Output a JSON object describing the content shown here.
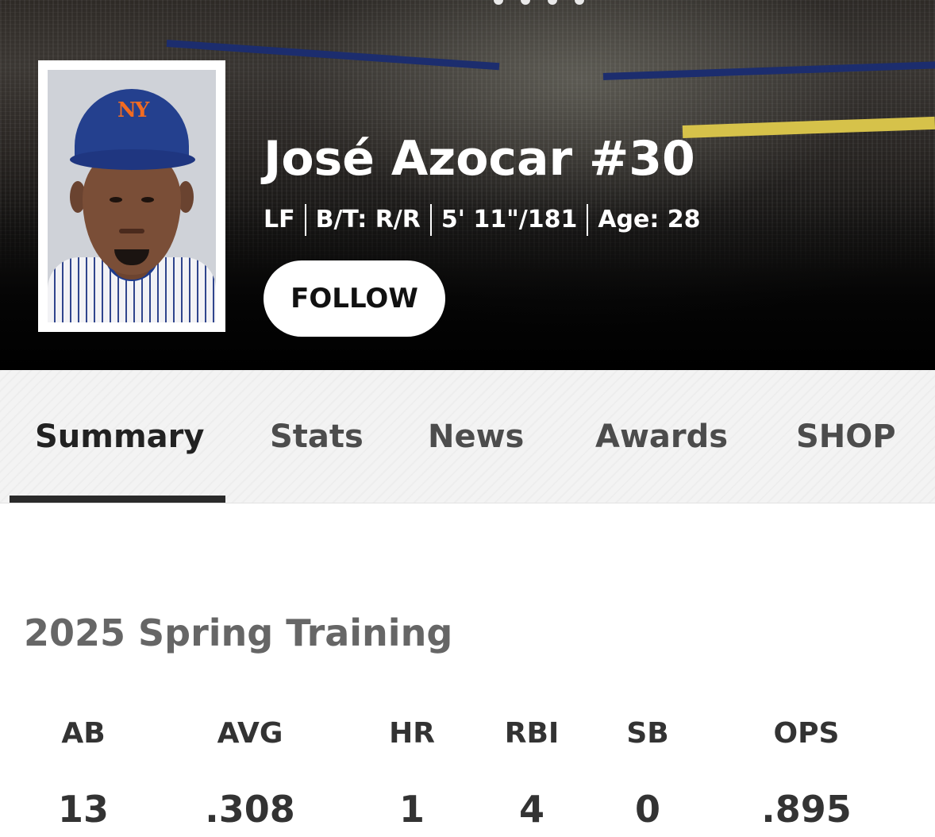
{
  "player": {
    "name": "José Azocar #30",
    "position": "LF",
    "bats_throws": "B/T: R/R",
    "height_weight": "5' 11\"/181",
    "age": "Age: 28",
    "cap_logo": "NY",
    "follow_label": "FOLLOW"
  },
  "tabs": [
    {
      "label": "Summary",
      "active": true
    },
    {
      "label": "Stats",
      "active": false
    },
    {
      "label": "News",
      "active": false
    },
    {
      "label": "Awards",
      "active": false
    },
    {
      "label": "SHOP",
      "active": false
    }
  ],
  "stats": {
    "season_title": "2025 Spring Training",
    "columns": [
      {
        "label": "AB",
        "value": "13"
      },
      {
        "label": "AVG",
        "value": ".308"
      },
      {
        "label": "HR",
        "value": "1"
      },
      {
        "label": "RBI",
        "value": "4"
      },
      {
        "label": "SB",
        "value": "0"
      },
      {
        "label": "OPS",
        "value": ".895"
      }
    ]
  },
  "colors": {
    "tab_active_underline": "#2a2a2a",
    "cap_blue": "#24408e",
    "cap_logo_orange": "#f26b21"
  }
}
